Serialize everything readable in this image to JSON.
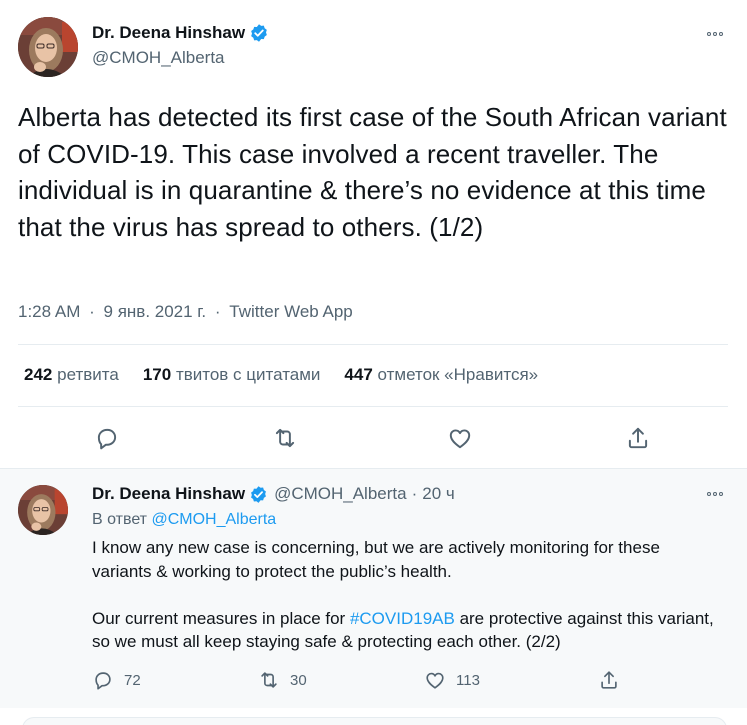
{
  "main_tweet": {
    "author_name": "Dr. Deena Hinshaw",
    "handle": "@CMOH_Alberta",
    "text": "Alberta has detected its first case of the South African variant of COVID-19. This case involved a recent traveller. The individual is in quarantine & there’s no evidence at this time that the virus has spread to others. (1/2)",
    "time": "1:28 AM",
    "date": "9 янв. 2021 г.",
    "source": "Twitter Web App",
    "meta_separator": "·",
    "stats": {
      "retweets_count": "242",
      "retweets_label": "ретвита",
      "quotes_count": "170",
      "quotes_label": "твитов с цитатами",
      "likes_count": "447",
      "likes_label": "отметок «Нравится»"
    },
    "actions": [
      "reply-icon",
      "retweet-icon",
      "like-icon",
      "share-icon"
    ]
  },
  "reply_tweet": {
    "author_name": "Dr. Deena Hinshaw",
    "handle": "@CMOH_Alberta",
    "separator": "·",
    "time_ago": "20 ч",
    "replying_prefix": "В ответ",
    "replying_to": "@CMOH_Alberta",
    "paragraph1": "I know any new case is concerning, but we are actively monitoring for these variants & working to protect the public’s health.",
    "paragraph2_before": "Our current measures in place for ",
    "paragraph2_hashtag": "#COVID19AB",
    "paragraph2_after": " are protective against this variant, so we must all keep staying safe & protecting each other. (2/2)",
    "reply_count": "72",
    "retweet_count": "30",
    "like_count": "113"
  },
  "colors": {
    "accent": "#1d9bf0",
    "text_primary": "#0f1419",
    "text_secondary": "#536471",
    "reply_bg": "#f7f9fa"
  }
}
